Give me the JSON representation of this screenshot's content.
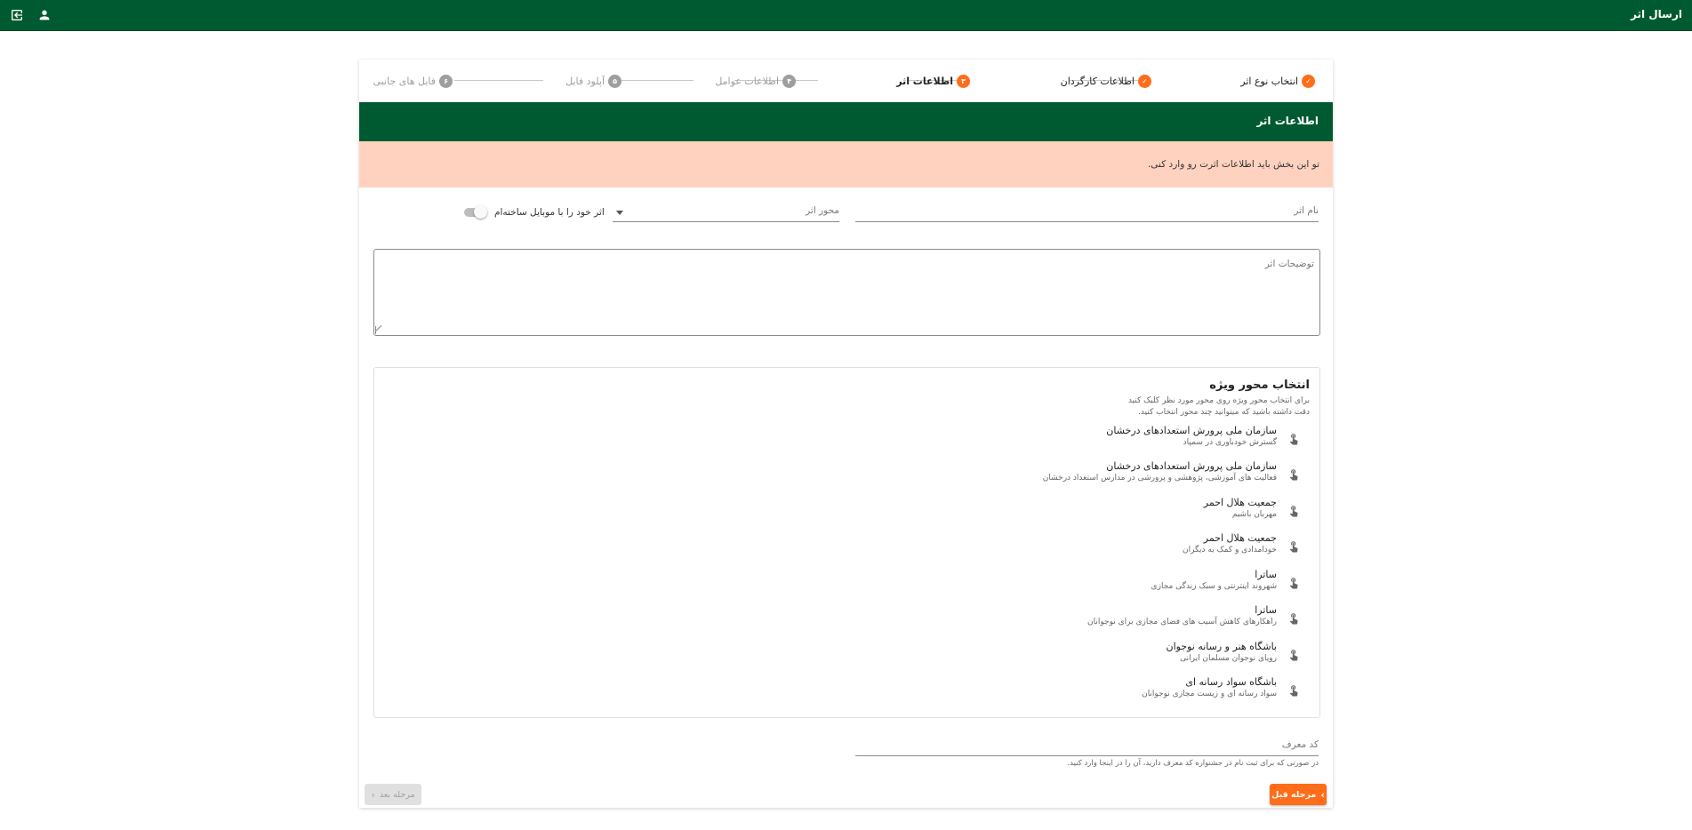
{
  "app": {
    "title": "ارسال اثر"
  },
  "stepper": {
    "steps": [
      {
        "label": "انتخاب نوع اثر",
        "marker": "✓",
        "state": "done"
      },
      {
        "label": "اطلاعات کارگردان",
        "marker": "✓",
        "state": "done"
      },
      {
        "label": "اطلاعات اثر",
        "marker": "۳",
        "state": "active"
      },
      {
        "label": "اطلاعات عوامل",
        "marker": "۴",
        "state": "pending"
      },
      {
        "label": "آپلود فایل",
        "marker": "۵",
        "state": "pending"
      },
      {
        "label": "فایل های جانبی",
        "marker": "۶",
        "state": "pending"
      }
    ]
  },
  "section": {
    "title": "اطلاعات اثر",
    "alert": "تو این بخش باید اطلاعات اثرت رو وارد کنی."
  },
  "form": {
    "name_placeholder": "نام اثر",
    "axis_placeholder": "محور اثر",
    "mobile_toggle_label": "اثر خود را با موبایل ساخته‌ام",
    "mobile_toggle_on": false,
    "description_placeholder": "توضیحات اثر",
    "ref_code_placeholder": "کد معرف",
    "ref_code_help": "در صورتی که برای ثبت نام در جشنواره کد معرف دارید، آن را در اینجا وارد کنید."
  },
  "special_axis": {
    "title": "انتخاب محور ویژه",
    "hint_line1": "برای انتخاب محور ویژه روی محور مورد نظر کلیک کنید",
    "hint_line2": "دقت داشته باشید که میتوانید چند محور انتخاب کنید.",
    "items": [
      {
        "org": "سازمان ملی پرورش استعدادهای درخشان",
        "topic": "گسترش خودباوری در سمپاد"
      },
      {
        "org": "سازمان ملی پرورش استعدادهای درخشان",
        "topic": "فعالیت های آموزشی، پژوهشی و پرورشی در مدارس استعداد درخشان"
      },
      {
        "org": "جمعیت هلال احمر",
        "topic": "مهربان باشیم"
      },
      {
        "org": "جمعیت هلال احمر",
        "topic": "خودامدادی و کمک به دیگران"
      },
      {
        "org": "ساترا",
        "topic": "شهروند اینترنتی و سبک زندگی مجازی"
      },
      {
        "org": "ساترا",
        "topic": "راهکارهای کاهش آسیب های فضای مجازی برای نوجوانان"
      },
      {
        "org": "باشگاه هنر و رسانه نوجوان",
        "topic": "رویای نوجوان مسلمان ایرانی"
      },
      {
        "org": "باشگاه سواد رسانه ای",
        "topic": "سواد رسانه ای و زیست مجازی نوجوانان"
      }
    ]
  },
  "buttons": {
    "prev_label": "مرحله قبل",
    "next_label": "مرحله بعد"
  },
  "icons": {
    "logout": "logout-icon",
    "account": "account-icon",
    "item": "touch-icon"
  },
  "colors": {
    "primary": "#005a31",
    "accent": "#ff6d1a",
    "alert_bg": "#ffd2c0"
  }
}
